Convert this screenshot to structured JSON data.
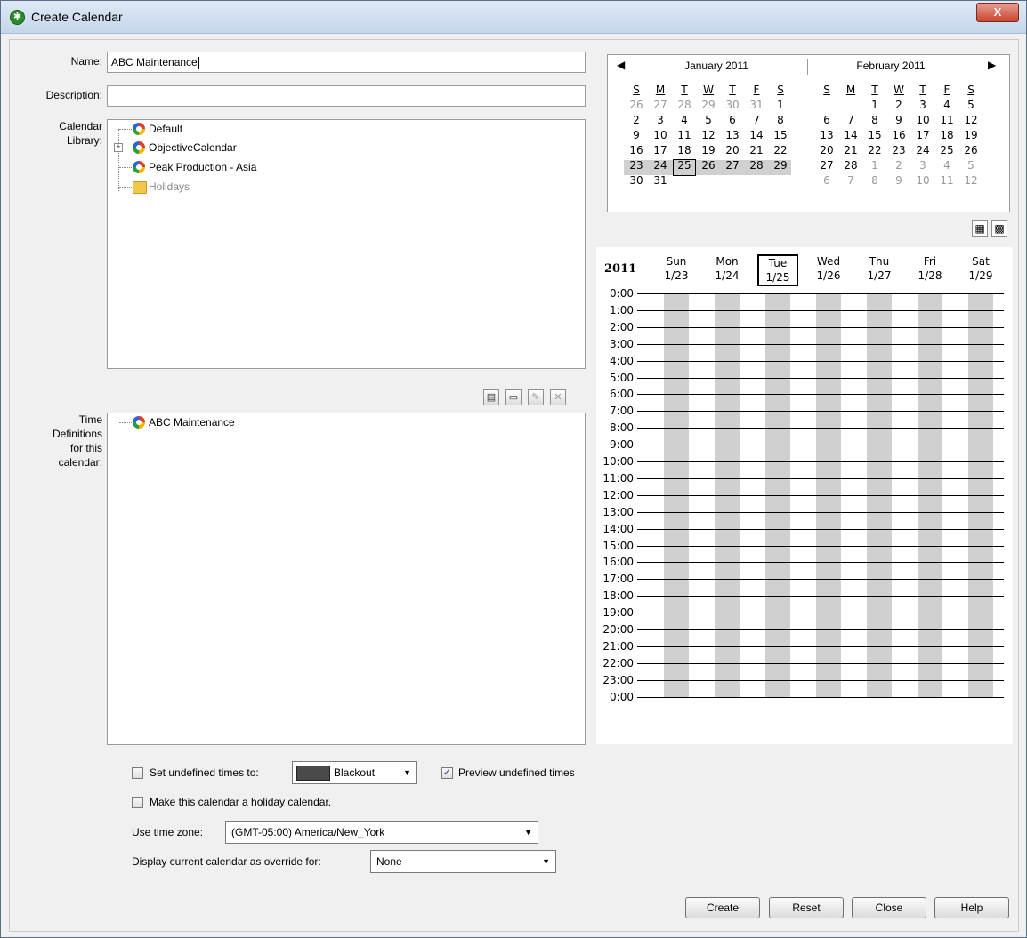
{
  "window": {
    "title": "Create Calendar",
    "close_glyph": "X"
  },
  "form": {
    "name_label": "Name:",
    "name_value": "ABC Maintenance",
    "description_label": "Description:",
    "description_value": "",
    "library_label_1": "Calendar",
    "library_label_2": "Library:",
    "library_items": [
      "Default",
      "ObjectiveCalendar",
      "Peak Production - Asia",
      "Holidays"
    ],
    "timedef_label": [
      "Time",
      "Definitions",
      "for this",
      "calendar:"
    ],
    "timedef_items": [
      "ABC Maintenance"
    ],
    "set_undefined_label": "Set undefined times to:",
    "set_undefined_checked": false,
    "undefined_value": "Blackout",
    "preview_label": "Preview undefined times",
    "preview_checked": true,
    "holiday_label": "Make this calendar a holiday calendar.",
    "holiday_checked": false,
    "timezone_label": "Use time zone:",
    "timezone_value": "(GMT-05:00) America/New_York",
    "override_label": "Display current calendar as override for:",
    "override_value": "None"
  },
  "mini_calendar": {
    "months": [
      {
        "title": "January 2011",
        "dow": [
          "S",
          "M",
          "T",
          "W",
          "T",
          "F",
          "S"
        ],
        "weeks": [
          [
            [
              "26",
              1
            ],
            [
              "27",
              1
            ],
            [
              "28",
              1
            ],
            [
              "29",
              1
            ],
            [
              "30",
              1
            ],
            [
              "31",
              1
            ],
            [
              "1",
              0
            ]
          ],
          [
            [
              "2",
              0
            ],
            [
              "3",
              0
            ],
            [
              "4",
              0
            ],
            [
              "5",
              0
            ],
            [
              "6",
              0
            ],
            [
              "7",
              0
            ],
            [
              "8",
              0
            ]
          ],
          [
            [
              "9",
              0
            ],
            [
              "10",
              0
            ],
            [
              "11",
              0
            ],
            [
              "12",
              0
            ],
            [
              "13",
              0
            ],
            [
              "14",
              0
            ],
            [
              "15",
              0
            ]
          ],
          [
            [
              "16",
              0
            ],
            [
              "17",
              0
            ],
            [
              "18",
              0
            ],
            [
              "19",
              0
            ],
            [
              "20",
              0
            ],
            [
              "21",
              0
            ],
            [
              "22",
              0
            ]
          ],
          [
            [
              "23",
              0
            ],
            [
              "24",
              0
            ],
            [
              "25",
              0
            ],
            [
              "26",
              0
            ],
            [
              "27",
              0
            ],
            [
              "28",
              0
            ],
            [
              "29",
              0
            ]
          ],
          [
            [
              "30",
              0
            ],
            [
              "31",
              0
            ],
            [
              "",
              0
            ],
            [
              "",
              0
            ],
            [
              "",
              0
            ],
            [
              "",
              0
            ],
            [
              "",
              0
            ]
          ]
        ]
      },
      {
        "title": "February 2011",
        "dow": [
          "S",
          "M",
          "T",
          "W",
          "T",
          "F",
          "S"
        ],
        "weeks": [
          [
            [
              "",
              0
            ],
            [
              "",
              0
            ],
            [
              "1",
              0
            ],
            [
              "2",
              0
            ],
            [
              "3",
              0
            ],
            [
              "4",
              0
            ],
            [
              "5",
              0
            ]
          ],
          [
            [
              "6",
              0
            ],
            [
              "7",
              0
            ],
            [
              "8",
              0
            ],
            [
              "9",
              0
            ],
            [
              "10",
              0
            ],
            [
              "11",
              0
            ],
            [
              "12",
              0
            ]
          ],
          [
            [
              "13",
              0
            ],
            [
              "14",
              0
            ],
            [
              "15",
              0
            ],
            [
              "16",
              0
            ],
            [
              "17",
              0
            ],
            [
              "18",
              0
            ],
            [
              "19",
              0
            ]
          ],
          [
            [
              "20",
              0
            ],
            [
              "21",
              0
            ],
            [
              "22",
              0
            ],
            [
              "23",
              0
            ],
            [
              "24",
              0
            ],
            [
              "25",
              0
            ],
            [
              "26",
              0
            ]
          ],
          [
            [
              "27",
              0
            ],
            [
              "28",
              0
            ],
            [
              "1",
              1
            ],
            [
              "2",
              1
            ],
            [
              "3",
              1
            ],
            [
              "4",
              1
            ],
            [
              "5",
              1
            ]
          ],
          [
            [
              "6",
              1
            ],
            [
              "7",
              1
            ],
            [
              "8",
              1
            ],
            [
              "9",
              1
            ],
            [
              "10",
              1
            ],
            [
              "11",
              1
            ],
            [
              "12",
              1
            ]
          ]
        ]
      }
    ],
    "selected_week_row": 4,
    "today": "25"
  },
  "week_view": {
    "year": "2011",
    "days": [
      {
        "name": "Sun",
        "date": "1/23"
      },
      {
        "name": "Mon",
        "date": "1/24"
      },
      {
        "name": "Tue",
        "date": "1/25"
      },
      {
        "name": "Wed",
        "date": "1/26"
      },
      {
        "name": "Thu",
        "date": "1/27"
      },
      {
        "name": "Fri",
        "date": "1/28"
      },
      {
        "name": "Sat",
        "date": "1/29"
      }
    ],
    "today_index": 2,
    "hours": [
      "0:00",
      "1:00",
      "2:00",
      "3:00",
      "4:00",
      "5:00",
      "6:00",
      "7:00",
      "8:00",
      "9:00",
      "10:00",
      "11:00",
      "12:00",
      "13:00",
      "14:00",
      "15:00",
      "16:00",
      "17:00",
      "18:00",
      "19:00",
      "20:00",
      "21:00",
      "22:00",
      "23:00",
      "0:00"
    ]
  },
  "buttons": {
    "create": "Create",
    "reset": "Reset",
    "close": "Close",
    "help": "Help"
  },
  "icons": {
    "nav_prev": "◀",
    "nav_next": "▶",
    "dropdown": "▼",
    "check": "✓",
    "list_view": "▦",
    "pattern_view": "▩",
    "new_def": "▤",
    "folder": "▭",
    "edit": "✎",
    "delete": "✕"
  }
}
